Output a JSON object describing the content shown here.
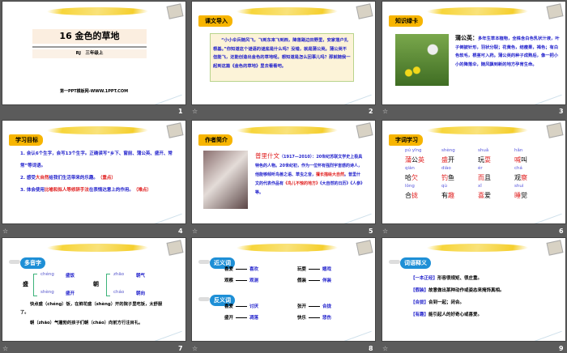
{
  "slides": [
    {
      "number": "1",
      "title": "16  金色的草地",
      "subtitle": "RJ　三年级上",
      "footer": "第一PPT模板网-WWW.1PPT.COM"
    },
    {
      "number": "2",
      "tag": "课文导入",
      "text": "“小小伞兵随风飞，飞到东来飞到西，降落路边田野里，安家落户扎根基。”你知道这个谜语的谜底是什么吗？没错，就是蒲公英。蒲公英不但能飞，还能创造出金色的草地呢。想知道是怎么回事儿吗？那就随我一起到这篇《金色的草地》里去看看吧。"
    },
    {
      "number": "3",
      "tag": "知识绿卡",
      "heading": "蒲公英：",
      "text": "多年生草本植物，全株含白色乳状汁液，叶子倒披针形，羽状分裂；花黄色，结瘦果，褐色；有白色软毛，根茎可入药。蒲公英的种子成熟后，像一把小小的降落伞，随风飘到新的地方孕育生命。"
    },
    {
      "number": "4",
      "tag": "学习目标",
      "goals": [
        {
          "a": "1. 会认6个生字，会写13个生字。正确读写“乡下、窗前、蒲公英、盛开、常常”等词语。",
          "b": "",
          "c": ""
        },
        {
          "a": "2. 感受",
          "b": "大自然",
          "c": "给我们生活带来的乐趣。",
          "d": "（重点）"
        },
        {
          "a": "3. 体会使用",
          "b": "比喻和拟人等修辞手法",
          "c": "在表情达意上的作用。",
          "d": "（难点）"
        }
      ]
    },
    {
      "number": "5",
      "tag": "作者简介",
      "name": "普里什文",
      "text1": "（1917—2010）：20世纪苏联文学史上极具特色的人物。20世纪初，作为一位怀有强烈宇宙感的诗人，他能够倾听鸟兽之语、草虫之音，",
      "red1": "擅长描绘大自然",
      "text2": "。普里什文的代表作品有",
      "red2": "《鸟儿不惊的地方》",
      "text3": "《大自然的日历》《人参》等。"
    },
    {
      "number": "6",
      "tag": "字词学习",
      "words": [
        {
          "py": "pú  yīng",
          "w1": "蒲",
          "w2": "公",
          "w3": "英",
          "red": [
            0,
            2
          ]
        },
        {
          "py": "shèng",
          "w1": "盛",
          "w2": "开",
          "w3": "",
          "red": [
            0
          ]
        },
        {
          "py": "shuǎ",
          "w1": "玩",
          "w2": "耍",
          "w3": "",
          "red": [
            1
          ]
        },
        {
          "py": "hǎn",
          "w1": "喊",
          "w2": "叫",
          "w3": "",
          "red": [
            0
          ]
        },
        {
          "py": "qiàn",
          "w1": "哈",
          "w2": "欠",
          "w3": "",
          "red": [
            1
          ]
        },
        {
          "py": "diào",
          "w1": "钓",
          "w2": "鱼",
          "w3": "",
          "red": [
            0
          ]
        },
        {
          "py": "ér",
          "w1": "而",
          "w2": "且",
          "w3": "",
          "red": [
            0
          ]
        },
        {
          "py": "chá",
          "w1": "观",
          "w2": "察",
          "w3": "",
          "red": [
            1
          ]
        },
        {
          "py": "lǒng",
          "w1": "合",
          "w2": "拢",
          "w3": "",
          "red": [
            1
          ]
        },
        {
          "py": "qù",
          "w1": "有",
          "w2": "趣",
          "w3": "",
          "red": [
            1
          ]
        },
        {
          "py": "xǐ",
          "w1": "喜",
          "w2": "爱",
          "w3": "",
          "red": [
            0
          ]
        },
        {
          "py": "shuì",
          "w1": "睡",
          "w2": "觉",
          "w3": "",
          "red": [
            0
          ]
        }
      ]
    },
    {
      "number": "7",
      "tag": "多音字",
      "char1": "盛",
      "p1a": "chéng",
      "w1a": "盛饭",
      "p1b": "shèng",
      "w1b": "盛开",
      "char2": "朝",
      "p2a": "zhāo",
      "w2a": "朝气",
      "p2b": "cháo",
      "w2b": "朝向",
      "s1": "快点盛（chéng）饭，在鲜花盛（shèng）开的院子里吃饭，太舒服了。",
      "s2": "朝（zhāo）气蓬勃的孩子们朝（cháo）向前方行注目礼。"
    },
    {
      "number": "8",
      "tag1": "近义词",
      "tag2": "反义词",
      "syn": [
        [
          "喜爱",
          "喜欢"
        ],
        [
          "观察",
          "观测"
        ],
        [
          "玩耍",
          "嬉戏"
        ],
        [
          "假装",
          "佯装"
        ]
      ],
      "ant": [
        [
          "喜爱",
          "讨厌"
        ],
        [
          "盛开",
          "凋落"
        ],
        [
          "张开",
          "合拢"
        ],
        [
          "快乐",
          "悲伤"
        ]
      ]
    },
    {
      "number": "9",
      "tag": "词语释义",
      "defs": [
        [
          "【一本正经】",
          "形容很规矩、很庄重。"
        ],
        [
          "【假装】",
          "故意做出某种动作或姿态来掩饰真相。"
        ],
        [
          "【合拢】",
          "合到一起；闭合。"
        ],
        [
          "【有趣】",
          "能引起人的好奇心或喜爱。"
        ]
      ]
    }
  ],
  "star_icon": "☆"
}
